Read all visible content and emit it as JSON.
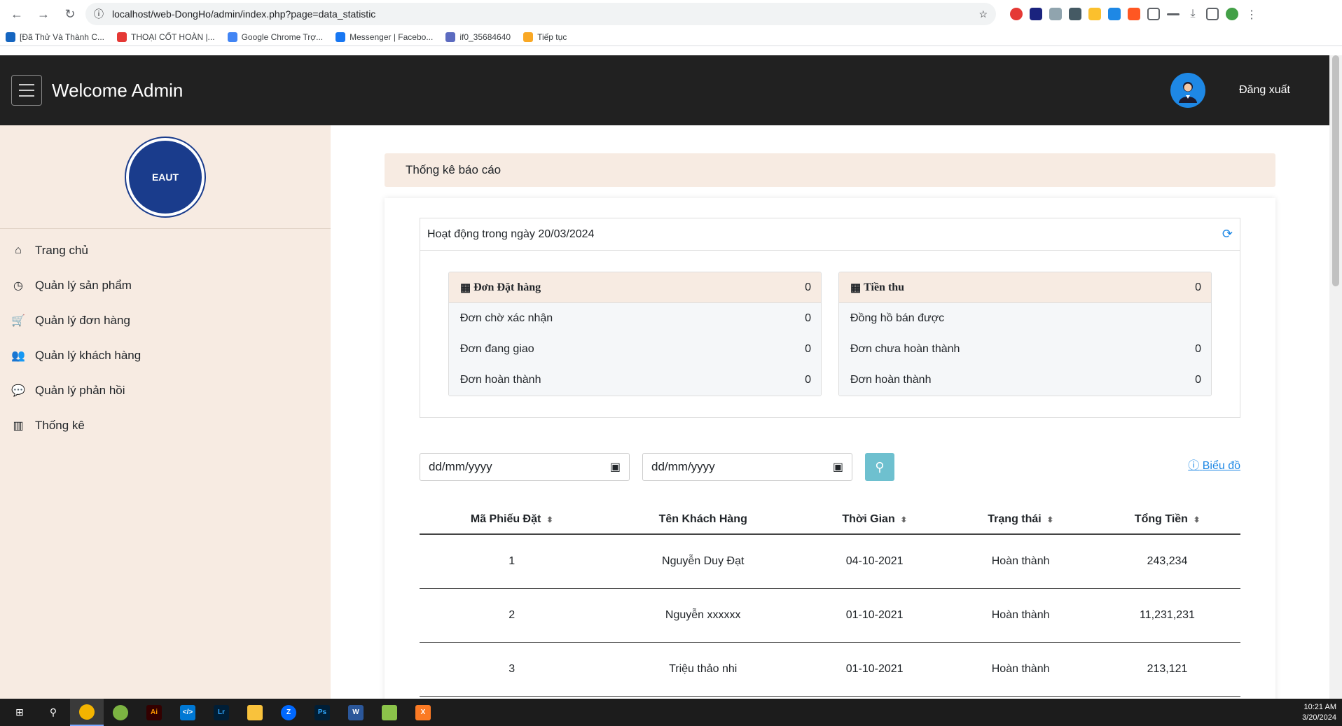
{
  "browser": {
    "url": "localhost/web-DongHo/admin/index.php?page=data_statistic",
    "bookmarks": [
      {
        "label": "[Đã Thử Và Thành C...",
        "color": "#1565c0"
      },
      {
        "label": "THOẠI CỐT HOÀN |...",
        "color": "#e53935"
      },
      {
        "label": "Google Chrome Trợ...",
        "color": "#4285f4"
      },
      {
        "label": "Messenger | Facebo...",
        "color": "#1877f2"
      },
      {
        "label": "if0_35684640",
        "color": "#5c6bc0"
      },
      {
        "label": "Tiếp tục",
        "color": "#f9a825"
      }
    ]
  },
  "header": {
    "title": "Welcome Admin",
    "logout": "Đăng xuất"
  },
  "sidebar": {
    "logo_text": "EAUT",
    "items": [
      {
        "label": "Trang chủ",
        "icon": "home-icon",
        "glyph": "⌂"
      },
      {
        "label": "Quản lý sản phẩm",
        "icon": "clock-icon",
        "glyph": "◷"
      },
      {
        "label": "Quản lý đơn hàng",
        "icon": "cart-icon",
        "glyph": "🛒"
      },
      {
        "label": "Quản lý khách hàng",
        "icon": "users-icon",
        "glyph": "👥"
      },
      {
        "label": "Quản lý phản hồi",
        "icon": "comment-icon",
        "glyph": "💬"
      },
      {
        "label": "Thống kê",
        "icon": "chart-icon",
        "glyph": "▥"
      }
    ]
  },
  "main": {
    "breadcrumb": "Thống kê báo cáo",
    "activity_title": "Hoạt động trong ngày 20/03/2024",
    "orders": {
      "title": "Đơn Đặt hàng",
      "total": "0",
      "rows": [
        {
          "label": "Đơn chờ xác nhận",
          "value": "0"
        },
        {
          "label": "Đơn đang giao",
          "value": "0"
        },
        {
          "label": "Đơn hoàn thành",
          "value": "0"
        }
      ]
    },
    "revenue": {
      "title": "Tiền thu",
      "total": "0",
      "rows": [
        {
          "label": "Đồng hồ bán được",
          "value": ""
        },
        {
          "label": "Đơn chưa hoàn thành",
          "value": "0"
        },
        {
          "label": "Đơn hoàn thành",
          "value": "0"
        }
      ]
    },
    "date_from_placeholder": "dd/mm/yyyy",
    "date_to_placeholder": "dd/mm/yyyy",
    "chart_link": "Biểu đồ",
    "table": {
      "columns": [
        "Mã Phiếu Đặt",
        "Tên Khách Hàng",
        "Thời Gian",
        "Trạng thái",
        "Tổng Tiền"
      ],
      "rows": [
        [
          "1",
          "Nguyễn Duy Đạt",
          "04-10-2021",
          "Hoàn thành",
          "243,234"
        ],
        [
          "2",
          "Nguyễn xxxxxx",
          "01-10-2021",
          "Hoàn thành",
          "11,231,231"
        ],
        [
          "3",
          "Triệu thảo nhi",
          "01-10-2021",
          "Hoàn thành",
          "213,121"
        ]
      ]
    }
  },
  "taskbar": {
    "time": "10:21 AM",
    "date": "3/20/2024"
  }
}
